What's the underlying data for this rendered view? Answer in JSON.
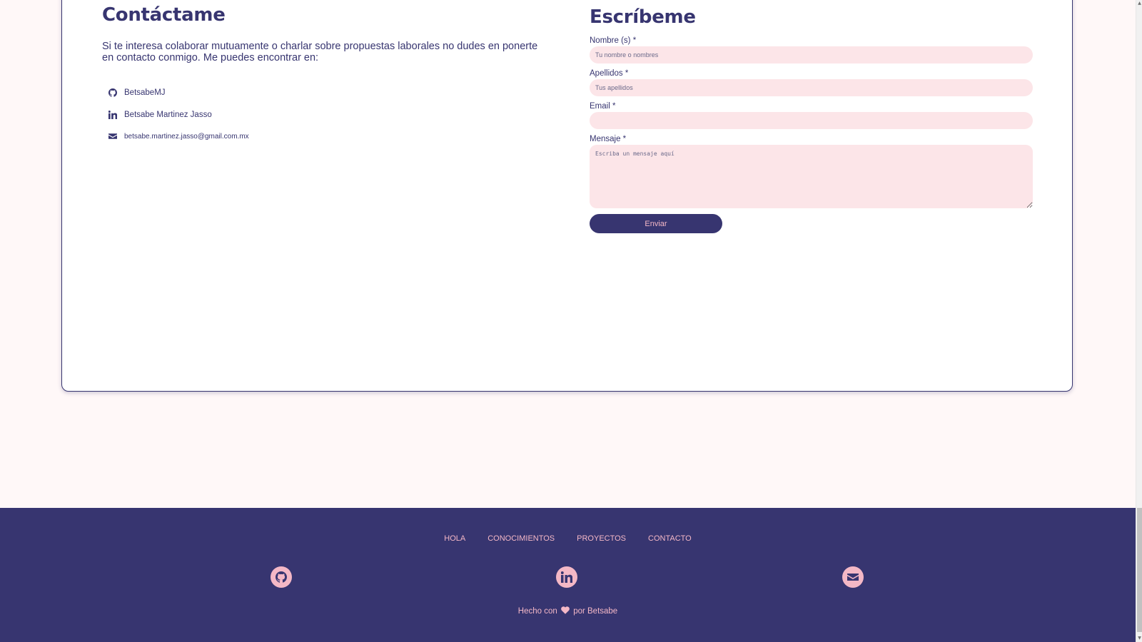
{
  "contact": {
    "title": "Contáctame",
    "intro": "Si te interesa colaborar mutuamente o charlar sobre propuestas laborales no dudes en ponerte en contacto conmigo. Me puedes encontrar en:",
    "items": [
      {
        "icon": "github-icon",
        "label": "BetsabeMJ"
      },
      {
        "icon": "linkedin-icon",
        "label": "Betsabe Martinez Jasso"
      },
      {
        "icon": "envelope-icon",
        "label": "betsabe.martinez.jasso@gmail.com.mx"
      }
    ]
  },
  "form": {
    "title": "Escríbeme",
    "name_label": "Nombre (s) *",
    "name_placeholder": "Tu nombre o nombres",
    "name_value": "",
    "lastname_label": "Apellidos *",
    "lastname_placeholder": "Tus apellidos",
    "lastname_value": "",
    "email_label": "Email *",
    "email_placeholder": "",
    "email_value": "",
    "message_label": "Mensaje *",
    "message_placeholder": "Escriba un mensaje aquí",
    "message_value": "",
    "submit_label": "Enviar"
  },
  "footer": {
    "nav": [
      "HOLA",
      "CONOCIMIENTOS",
      "PROYECTOS",
      "CONTACTO"
    ],
    "social": [
      "github-icon",
      "linkedin-icon",
      "envelope-icon"
    ],
    "made_prefix": "Hecho con",
    "made_suffix": "por Betsabe"
  },
  "colors": {
    "primary": "#373570",
    "accent": "#f4b8c6",
    "field_bg": "#fce5e8",
    "page_bg": "#fff8f8"
  }
}
